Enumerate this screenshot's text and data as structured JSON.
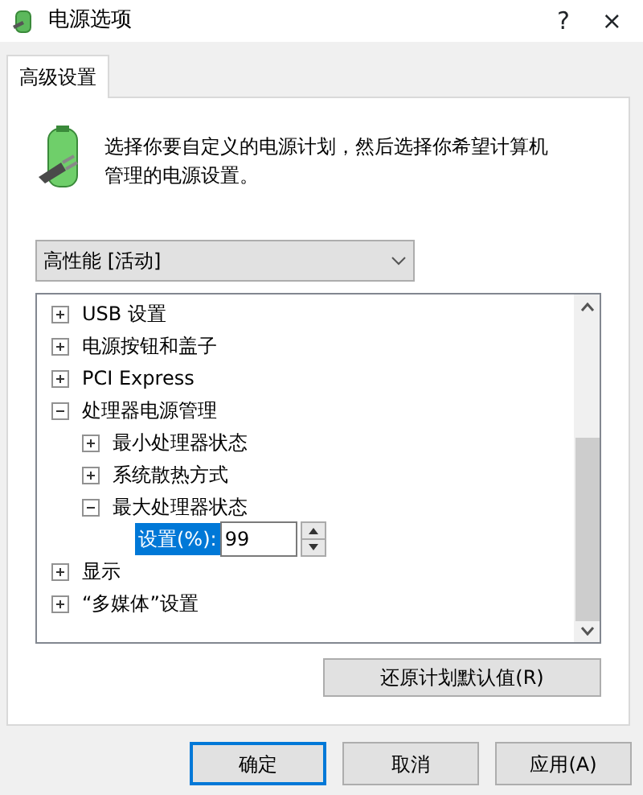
{
  "window": {
    "title": "电源选项",
    "help": "?",
    "close": "×"
  },
  "tabs": [
    {
      "label": "高级设置",
      "selected": true
    }
  ],
  "intro": "选择你要自定义的电源计划，然后选择你希望计算机管理的电源设置。",
  "plan_dropdown": {
    "value": "高性能 [活动]"
  },
  "settings_tree": [
    {
      "label": "USB 设置",
      "expanded": false
    },
    {
      "label": "电源按钮和盖子",
      "expanded": false
    },
    {
      "label": "PCI Express",
      "expanded": false
    },
    {
      "label": "处理器电源管理",
      "expanded": true,
      "children": [
        {
          "label": "最小处理器状态",
          "expanded": false
        },
        {
          "label": "系统散热方式",
          "expanded": false
        },
        {
          "label": "最大处理器状态",
          "expanded": true,
          "children": [
            {
              "kind": "setting",
              "label": "设置(%):",
              "value": "99",
              "selected": true
            }
          ]
        }
      ]
    },
    {
      "label": "显示",
      "expanded": false
    },
    {
      "label": "“多媒体”设置",
      "expanded": false
    }
  ],
  "restore_button": "还原计划默认值(R)",
  "buttons": [
    {
      "label": "确定",
      "default": true
    },
    {
      "label": "取消",
      "default": false
    },
    {
      "label": "应用(A)",
      "default": false
    }
  ]
}
